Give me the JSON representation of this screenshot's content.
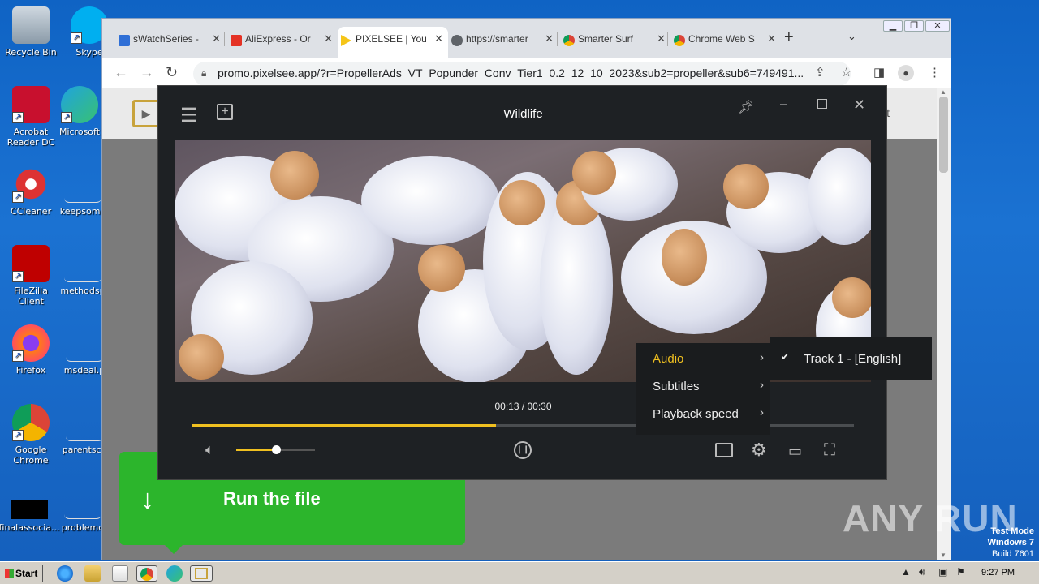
{
  "desktop": {
    "icons": [
      {
        "label": "Recycle Bin"
      },
      {
        "label": "Skype"
      },
      {
        "label": "Acrobat Reader DC"
      },
      {
        "label": "Microsoft"
      },
      {
        "label": "CCleaner"
      },
      {
        "label": "keepsome"
      },
      {
        "label": "FileZilla Client"
      },
      {
        "label": "methodsp"
      },
      {
        "label": "Firefox"
      },
      {
        "label": "msdeal.p"
      },
      {
        "label": "Google Chrome"
      },
      {
        "label": "parentsca"
      },
      {
        "label": "finalassocia..."
      },
      {
        "label": "problemd"
      }
    ]
  },
  "browser": {
    "tabs": [
      {
        "title": "sWatchSeries -",
        "icon": "watchseries-favicon",
        "color": "#2f6fd6"
      },
      {
        "title": "AliExpress - Or",
        "icon": "aliexpress-favicon",
        "color": "#e43225"
      },
      {
        "title": "PIXELSEE | You",
        "icon": "pixelsee-favicon",
        "color": "#f5c518"
      },
      {
        "title": "https://smarter",
        "icon": "globe-favicon",
        "color": "#5f6368"
      },
      {
        "title": "Smarter Surf",
        "icon": "chrome-favicon",
        "color": "#db4437"
      },
      {
        "title": "Chrome Web S",
        "icon": "chrome-favicon",
        "color": "#db4437"
      }
    ],
    "url": "promo.pixelsee.app/?r=PropellerAds_VT_Popunder_Conv_Tier1_0.2_12_10_2023&sub2=propeller&sub6=749491..."
  },
  "site": {
    "support_label": "port"
  },
  "banner": {
    "text": "Run the file"
  },
  "player": {
    "title": "Wildlife",
    "time": "00:13 / 00:30",
    "progress": 0.46,
    "volume": 0.5,
    "settings_menu": [
      {
        "label": "Audio",
        "active": true
      },
      {
        "label": "Subtitles",
        "active": false
      },
      {
        "label": "Playback speed",
        "active": false
      }
    ],
    "audio_track": "Track 1 - [English]"
  },
  "watermark": "ANY RUN",
  "system": {
    "test_mode": "Test Mode",
    "os": "Windows 7",
    "build": "Build 7601",
    "clock": "9:27 PM",
    "start_label": "Start"
  }
}
